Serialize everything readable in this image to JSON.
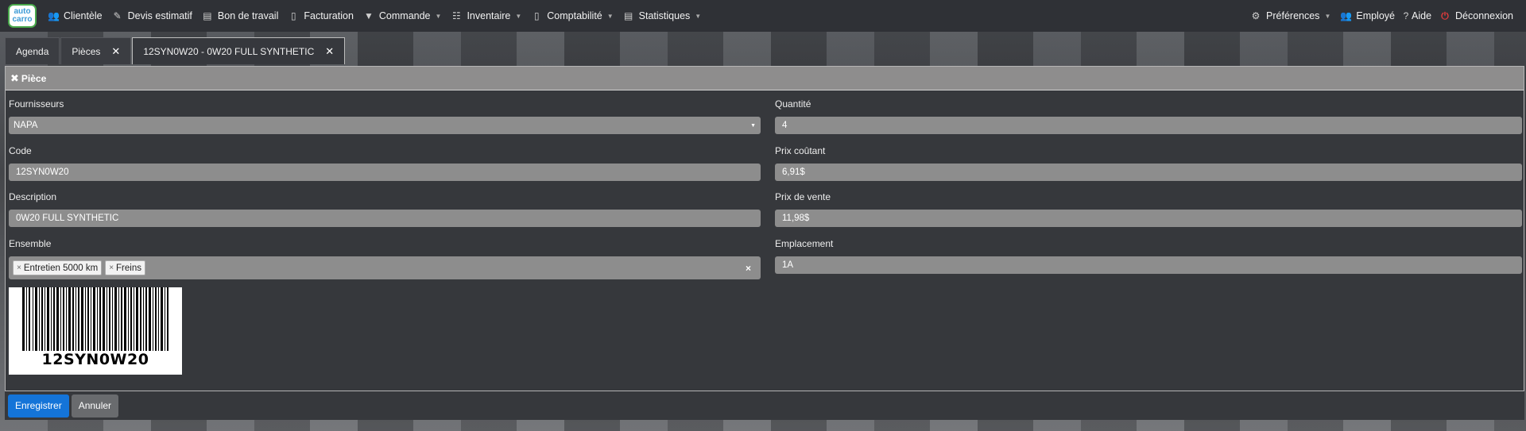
{
  "logo": {
    "line1": "auto",
    "line2": "carro"
  },
  "nav": {
    "left": [
      {
        "label": "Clientèle",
        "icon": "users-icon",
        "dropdown": false
      },
      {
        "label": "Devis estimatif",
        "icon": "edit-icon",
        "dropdown": false
      },
      {
        "label": "Bon de travail",
        "icon": "document-icon",
        "dropdown": false
      },
      {
        "label": "Facturation",
        "icon": "file-icon",
        "dropdown": false
      },
      {
        "label": "Commande",
        "icon": "basket-icon",
        "dropdown": true
      },
      {
        "label": "Inventaire",
        "icon": "list-icon",
        "dropdown": true
      },
      {
        "label": "Comptabilité",
        "icon": "bar-chart-icon",
        "dropdown": true
      },
      {
        "label": "Statistiques",
        "icon": "chart-icon",
        "dropdown": true
      }
    ],
    "right": [
      {
        "label": "Préférences",
        "icon": "gear-icon",
        "dropdown": true
      },
      {
        "label": "Employé",
        "icon": "users-icon",
        "dropdown": false
      },
      {
        "label": "Aide",
        "icon": "question-icon",
        "dropdown": false
      },
      {
        "label": "Déconnexion",
        "icon": "power-icon",
        "dropdown": false
      }
    ]
  },
  "tabs": [
    {
      "label": "Agenda",
      "closable": false
    },
    {
      "label": "Pièces",
      "closable": true
    },
    {
      "label": "12SYN0W20 - 0W20 FULL SYNTHETIC",
      "closable": true,
      "active": true
    }
  ],
  "panel": {
    "title": "Pièce",
    "fields": {
      "fournisseurs": {
        "label": "Fournisseurs",
        "value": "NAPA"
      },
      "code": {
        "label": "Code",
        "value": "12SYN0W20"
      },
      "description": {
        "label": "Description",
        "value": "0W20 FULL SYNTHETIC"
      },
      "ensemble": {
        "label": "Ensemble",
        "tags": [
          "Entretien 5000 km",
          "Freins"
        ]
      },
      "quantite": {
        "label": "Quantité",
        "value": "4"
      },
      "prix_coutant": {
        "label": "Prix coûtant",
        "value": "6,91$"
      },
      "prix_vente": {
        "label": "Prix de vente",
        "value": "11,98$"
      },
      "emplacement": {
        "label": "Emplacement",
        "value": "1A"
      }
    },
    "barcode_text": "12SYN0W20"
  },
  "footer": {
    "save_label": "Enregistrer",
    "cancel_label": "Annuler"
  },
  "colors": {
    "primary": "#1474d8",
    "panel_header": "#8e8d8d",
    "field_bg": "#8d8d8d",
    "power": "#e23b3b"
  }
}
